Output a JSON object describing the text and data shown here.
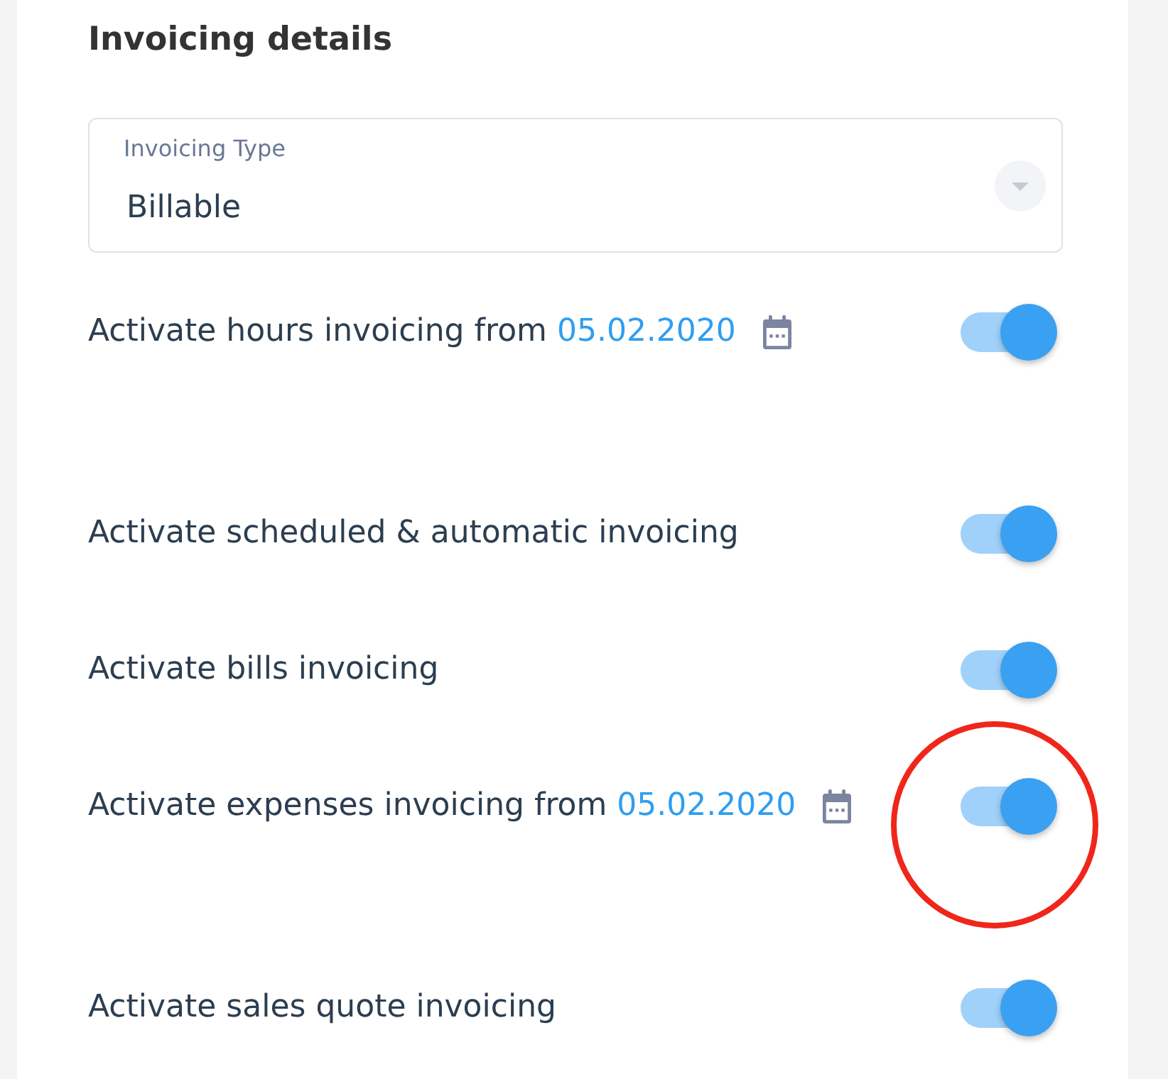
{
  "section": {
    "title": "Invoicing details"
  },
  "invoicing_type": {
    "label": "Invoicing Type",
    "value": "Billable"
  },
  "rows": [
    {
      "kind": "dated",
      "label": "Activate hours invoicing from",
      "date": "05.02.2020",
      "on": true,
      "highlighted": false
    },
    {
      "kind": "plain",
      "label": "Activate scheduled & automatic invoicing",
      "on": true,
      "highlighted": false
    },
    {
      "kind": "plain",
      "label": "Activate bills invoicing",
      "on": true,
      "highlighted": false
    },
    {
      "kind": "dated",
      "label": "Activate expenses invoicing from",
      "date": "05.02.2020",
      "on": true,
      "highlighted": true
    },
    {
      "kind": "plain",
      "label": "Activate sales quote invoicing",
      "on": true,
      "highlighted": false
    }
  ]
}
